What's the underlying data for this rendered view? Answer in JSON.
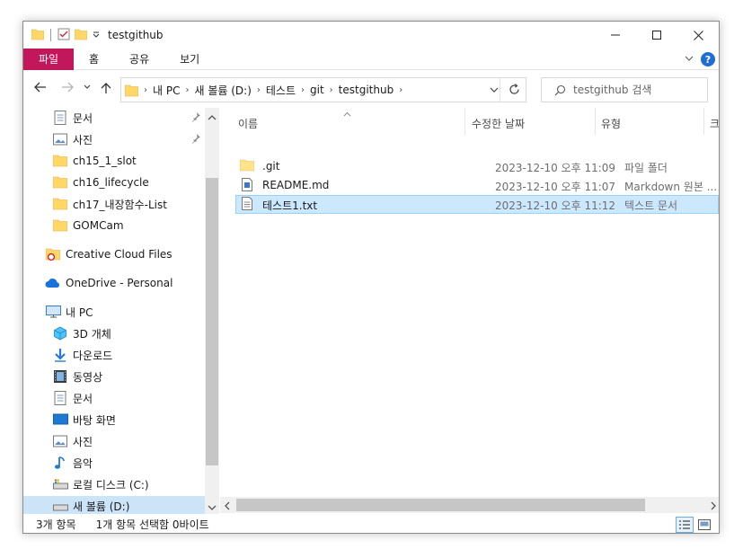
{
  "window": {
    "title": "testgithub"
  },
  "ribbon": {
    "file_tab": "파일",
    "tabs": [
      "홈",
      "공유",
      "보기"
    ],
    "help": "?"
  },
  "address": {
    "crumbs": [
      "내 PC",
      "새 볼륨 (D:)",
      "테스트",
      "git",
      "testgithub"
    ]
  },
  "search": {
    "placeholder": "testgithub 검색"
  },
  "nav": {
    "items": [
      {
        "label": "문서",
        "icon": "documents-icon",
        "pinned": true
      },
      {
        "label": "사진",
        "icon": "pictures-icon",
        "pinned": true
      },
      {
        "label": "ch15_1_slot",
        "icon": "folder-icon"
      },
      {
        "label": "ch16_lifecycle",
        "icon": "folder-icon"
      },
      {
        "label": "ch17_내장함수-List",
        "icon": "folder-icon"
      },
      {
        "label": "GOMCam",
        "icon": "folder-icon"
      },
      {
        "label": "Creative Cloud Files",
        "icon": "creative-cloud-icon"
      },
      {
        "label": "OneDrive - Personal",
        "icon": "onedrive-cloud-icon"
      },
      {
        "label": "내 PC",
        "icon": "this-pc-icon"
      },
      {
        "label": "3D 개체",
        "icon": "3d-objects-icon"
      },
      {
        "label": "다운로드",
        "icon": "downloads-icon"
      },
      {
        "label": "동영상",
        "icon": "videos-icon"
      },
      {
        "label": "문서",
        "icon": "documents-icon"
      },
      {
        "label": "바탕 화면",
        "icon": "desktop-icon"
      },
      {
        "label": "사진",
        "icon": "pictures-icon"
      },
      {
        "label": "음악",
        "icon": "music-icon"
      },
      {
        "label": "로컬 디스크 (C:)",
        "icon": "drive-icon"
      },
      {
        "label": "새 볼륨 (D:)",
        "icon": "drive-icon",
        "selected": true
      }
    ]
  },
  "columns": {
    "name": "이름",
    "modified": "수정한 날짜",
    "type": "유형",
    "size": "크"
  },
  "files": [
    {
      "name": ".git",
      "modified": "2023-12-10 오후 11:09",
      "type": "파일 폴더",
      "icon": "folder-icon"
    },
    {
      "name": "README.md",
      "modified": "2023-12-10 오후 11:07",
      "type": "Markdown 원본 ...",
      "icon": "markdown-file-icon"
    },
    {
      "name": "테스트1.txt",
      "modified": "2023-12-10 오후 11:12",
      "type": "텍스트 문서",
      "icon": "text-file-icon",
      "selected": true
    }
  ],
  "status": {
    "item_count": "3개 항목",
    "selection": "1개 항목 선택함 0바이트"
  },
  "colors": {
    "file_tab": "#c2185b",
    "selection": "#cce8ff",
    "nav_selection": "#cce4f7",
    "folder": "#ffd767",
    "accent": "#1f6ed4"
  }
}
